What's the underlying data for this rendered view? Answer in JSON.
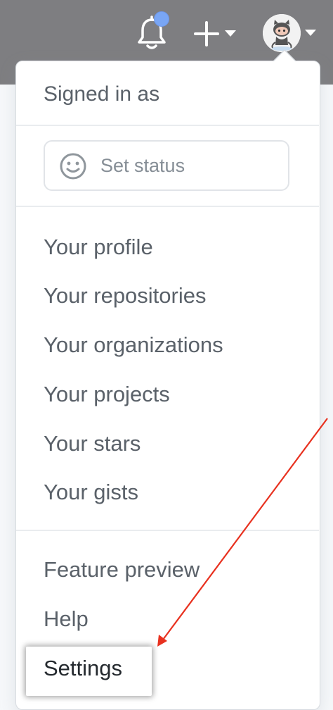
{
  "header": {
    "notification_icon": "bell-icon",
    "create_icon": "plus-icon",
    "avatar_icon": "octocat-avatar",
    "colors": {
      "bar": "#7e7e81",
      "notification_dot": "#79a6f5"
    }
  },
  "dropdown": {
    "signed_in_label": "Signed in as",
    "status": {
      "icon": "smiley-icon",
      "label": "Set status"
    },
    "profile_items": [
      {
        "label": "Your profile"
      },
      {
        "label": "Your repositories"
      },
      {
        "label": "Your organizations"
      },
      {
        "label": "Your projects"
      },
      {
        "label": "Your stars"
      },
      {
        "label": "Your gists"
      }
    ],
    "other_items": [
      {
        "label": "Feature preview"
      },
      {
        "label": "Help"
      },
      {
        "label": "Settings"
      }
    ]
  },
  "annotation": {
    "arrow_color": "#e8311f",
    "points_to": "Settings"
  }
}
